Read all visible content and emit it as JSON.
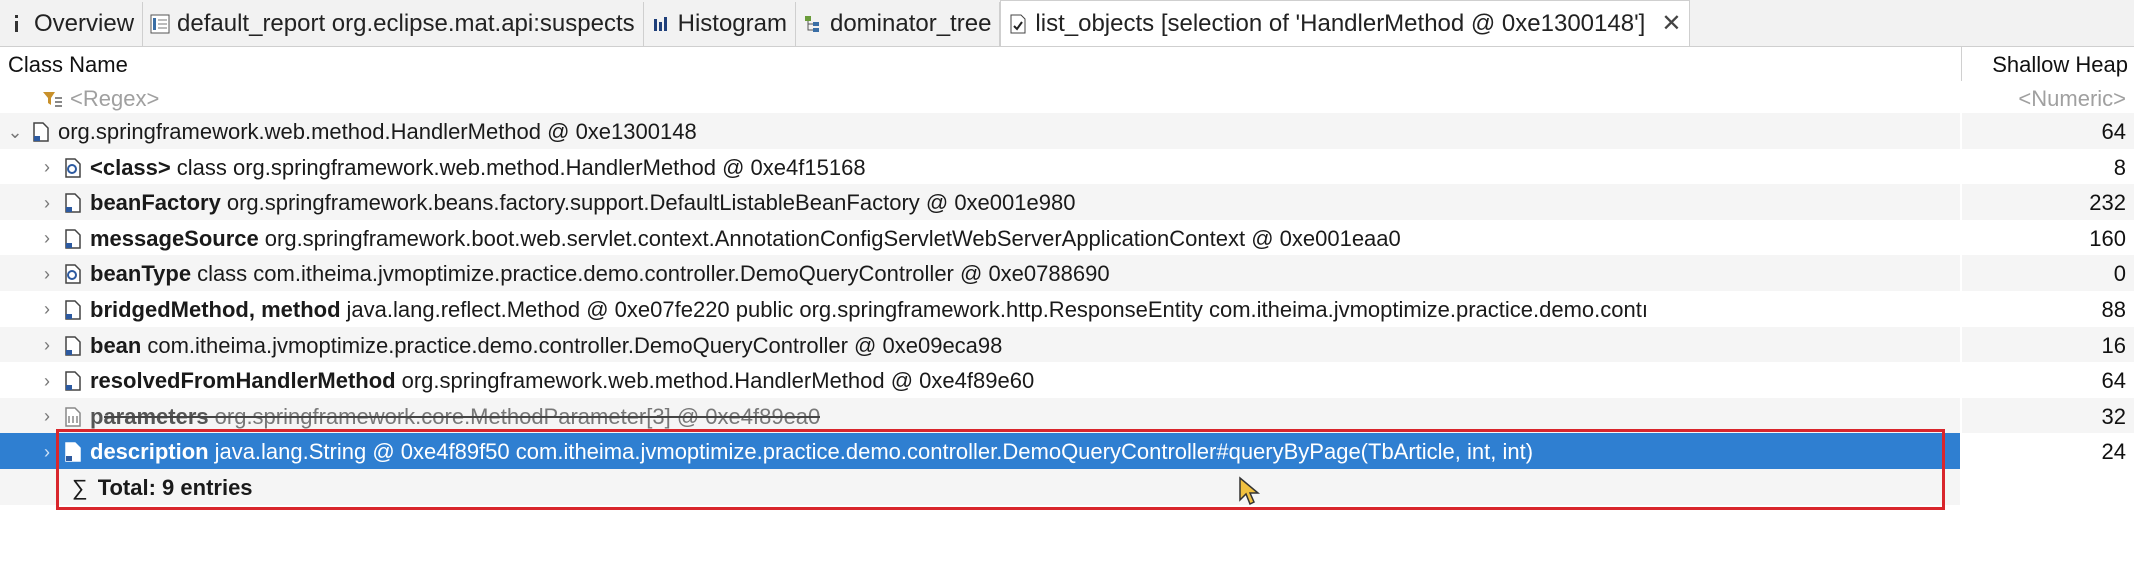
{
  "tabs": [
    {
      "label": "Overview",
      "icon": "info-icon",
      "active": false
    },
    {
      "label": "default_report  org.eclipse.mat.api:suspects",
      "icon": "report-icon",
      "active": false
    },
    {
      "label": "Histogram",
      "icon": "histogram-icon",
      "active": false
    },
    {
      "label": "dominator_tree",
      "icon": "tree-icon",
      "active": false
    },
    {
      "label": "list_objects  [selection of 'HandlerMethod @ 0xe1300148']",
      "icon": "list-icon",
      "active": true
    }
  ],
  "table": {
    "col_name": "Class Name",
    "col_heap": "Shallow Heap",
    "filter": {
      "regex_placeholder": "<Regex>",
      "numeric_placeholder": "<Numeric>"
    },
    "root": {
      "name": "org.springframework.web.method.HandlerMethod @ 0xe1300148",
      "heap": "64"
    },
    "rows": [
      {
        "field": "<class>",
        "value": "class org.springframework.web.method.HandlerMethod @ 0xe4f15168",
        "heap": "8",
        "icon": "class-object-icon"
      },
      {
        "field": "beanFactory",
        "value": "org.springframework.beans.factory.support.DefaultListableBeanFactory @ 0xe001e980",
        "heap": "232",
        "icon": "object-icon"
      },
      {
        "field": "messageSource",
        "value": "org.springframework.boot.web.servlet.context.AnnotationConfigServletWebServerApplicationContext @ 0xe001eaa0",
        "heap": "160",
        "icon": "object-icon"
      },
      {
        "field": "beanType",
        "value": "class com.itheima.jvmoptimize.practice.demo.controller.DemoQueryController @ 0xe0788690",
        "heap": "0",
        "icon": "class-object-icon"
      },
      {
        "field": "bridgedMethod, method",
        "value": "java.lang.reflect.Method @ 0xe07fe220  public org.springframework.http.ResponseEntity com.itheima.jvmoptimize.practice.demo.contı",
        "heap": "88",
        "icon": "object-icon"
      },
      {
        "field": "bean",
        "value": "com.itheima.jvmoptimize.practice.demo.controller.DemoQueryController @ 0xe09eca98",
        "heap": "16",
        "icon": "object-icon"
      },
      {
        "field": "resolvedFromHandlerMethod",
        "value": "org.springframework.web.method.HandlerMethod @ 0xe4f89e60",
        "heap": "64",
        "icon": "object-icon"
      },
      {
        "field": "parameters",
        "value": "org.springframework.core.MethodParameter[3] @ 0xe4f89ea0",
        "heap": "32",
        "icon": "array-icon"
      },
      {
        "field": "description",
        "value": "java.lang.String @ 0xe4f89f50  com.itheima.jvmoptimize.practice.demo.controller.DemoQueryController#queryByPage(TbArticle, int, int)",
        "heap": "24",
        "icon": "object-icon"
      }
    ],
    "total": "Total: 9 entries"
  },
  "colors": {
    "selection": "#2f7fd1",
    "highlight_border": "#d9262c",
    "alt_row": "#f5f5f5"
  }
}
